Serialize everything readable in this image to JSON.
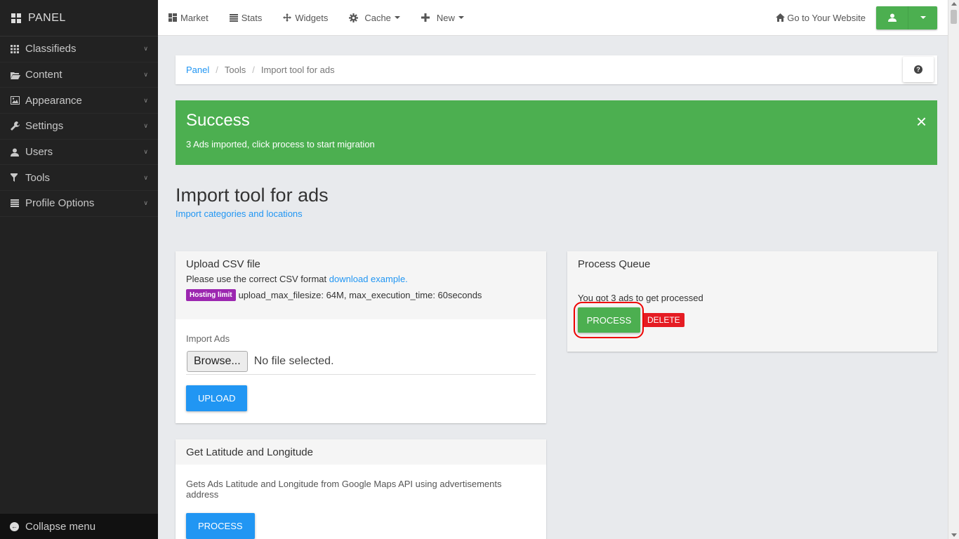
{
  "brand": "PANEL",
  "sidebar": {
    "items": [
      {
        "label": "Classifieds",
        "icon": "grid-icon"
      },
      {
        "label": "Content",
        "icon": "folder-open-icon"
      },
      {
        "label": "Appearance",
        "icon": "picture-icon"
      },
      {
        "label": "Settings",
        "icon": "wrench-icon"
      },
      {
        "label": "Users",
        "icon": "user-icon"
      },
      {
        "label": "Tools",
        "icon": "filter-icon"
      },
      {
        "label": "Profile Options",
        "icon": "list-icon"
      }
    ],
    "collapse": "Collapse menu"
  },
  "topbar": {
    "nav": [
      {
        "label": "Market",
        "icon": "dashboard-icon"
      },
      {
        "label": "Stats",
        "icon": "align-justify-icon"
      },
      {
        "label": "Widgets",
        "icon": "move-icon"
      },
      {
        "label": "Cache",
        "icon": "cog-icon",
        "dropdown": true
      },
      {
        "label": "New",
        "icon": "plus-icon",
        "dropdown": true
      }
    ],
    "goto": "Go to Your Website"
  },
  "breadcrumb": {
    "items": [
      "Panel",
      "Tools",
      "Import tool for ads"
    ]
  },
  "alert": {
    "title": "Success",
    "message": "3 Ads imported, click process to start migration",
    "close": "×"
  },
  "page": {
    "title": "Import tool for ads",
    "sublink": "Import categories and locations"
  },
  "upload_panel": {
    "title": "Upload CSV file",
    "desc": "Please use the correct CSV format ",
    "desc_link": "download example.",
    "badge": "Hosting limit",
    "limit_text": "upload_max_filesize: 64M, max_execution_time: 60seconds",
    "import_label": "Import Ads",
    "browse": "Browse...",
    "no_file": "No file selected.",
    "upload_btn": "UPLOAD"
  },
  "latlng_panel": {
    "title": "Get Latitude and Longitude",
    "desc": "Gets Ads Latitude and Longitude from Google Maps API using advertisements address",
    "process_btn": "PROCESS"
  },
  "queue_panel": {
    "title": "Process Queue",
    "got": "You got 3 ads to get processed",
    "process_btn": "PROCESS",
    "delete_btn": "DELETE"
  },
  "colors": {
    "sidebar_bg": "#222222",
    "success": "#4caf50",
    "primary": "#2196f3",
    "danger": "#e51c23",
    "badge": "#9c27b0",
    "highlight_ring": "#ee0000"
  }
}
